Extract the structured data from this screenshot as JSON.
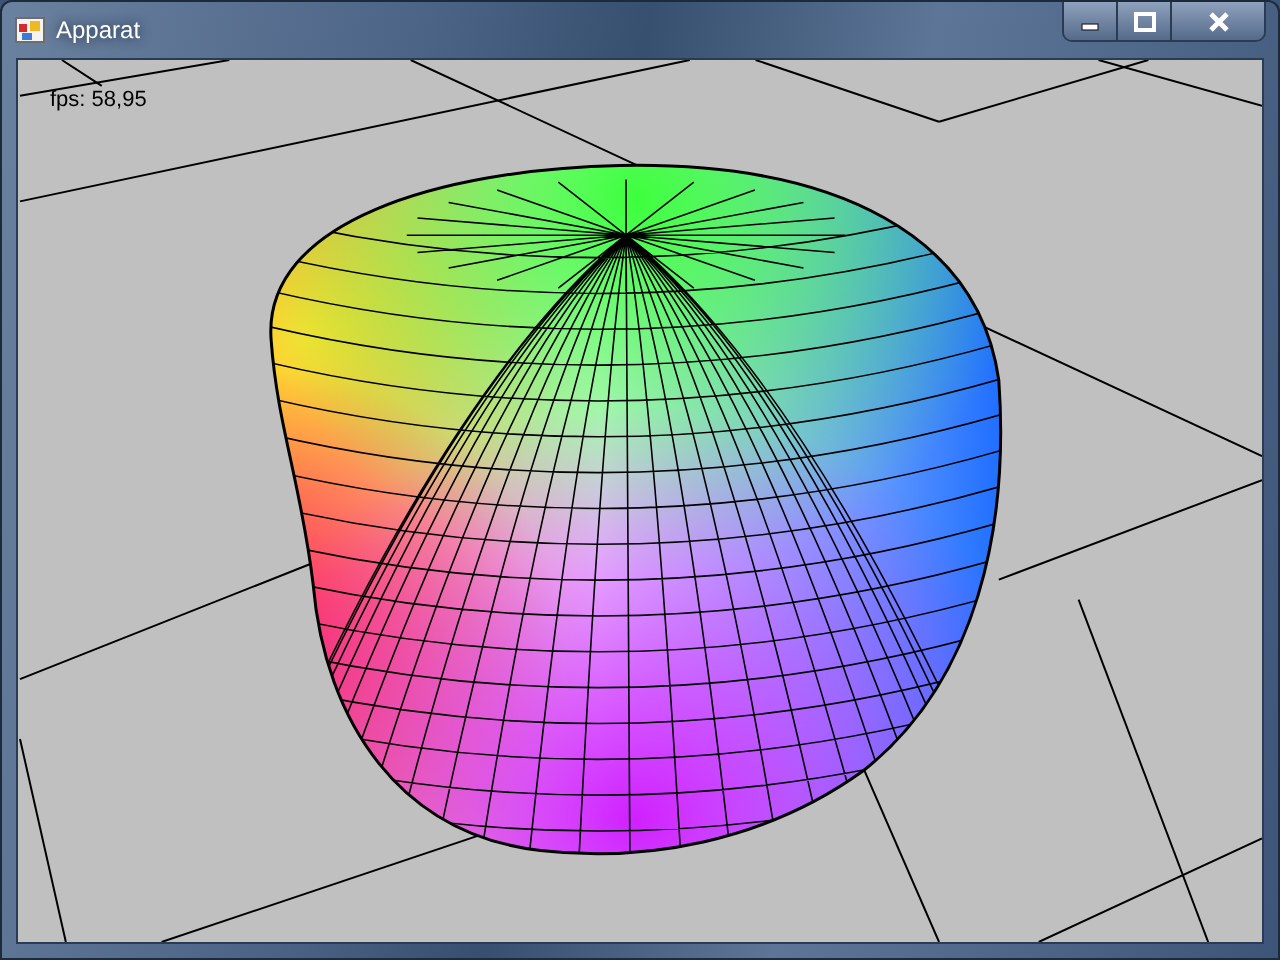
{
  "window": {
    "title": "Apparat"
  },
  "viewport": {
    "fps_label": "fps: 58,95"
  }
}
